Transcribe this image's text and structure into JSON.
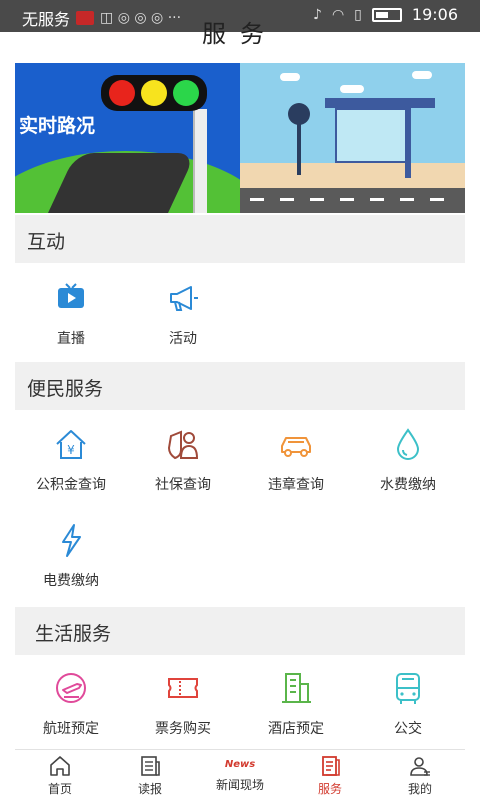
{
  "status_bar": {
    "carrier": "无服务",
    "time": "19:06"
  },
  "header": {
    "title": "服务"
  },
  "banner": {
    "left_text": "实时路况"
  },
  "sections": {
    "interaction": {
      "title": "互动",
      "items": [
        {
          "label": "直播",
          "icon": "tv-icon"
        },
        {
          "label": "活动",
          "icon": "megaphone-icon"
        }
      ]
    },
    "convenience": {
      "title": "便民服务",
      "items": [
        {
          "label": "公积金查询",
          "icon": "house-yen-icon"
        },
        {
          "label": "社保查询",
          "icon": "shield-user-icon"
        },
        {
          "label": "违章查询",
          "icon": "car-icon"
        },
        {
          "label": "水费缴纳",
          "icon": "water-drop-icon"
        },
        {
          "label": "电费缴纳",
          "icon": "lightning-icon"
        }
      ]
    },
    "life": {
      "title": "生活服务",
      "items": [
        {
          "label": "航班预定",
          "icon": "plane-icon"
        },
        {
          "label": "票务购买",
          "icon": "ticket-icon"
        },
        {
          "label": "酒店预定",
          "icon": "hotel-icon"
        },
        {
          "label": "公交",
          "icon": "bus-icon"
        }
      ]
    }
  },
  "bottom_nav": {
    "items": [
      {
        "label": "首页",
        "icon": "home-icon"
      },
      {
        "label": "读报",
        "icon": "newspaper-icon"
      },
      {
        "label": "新闻现场",
        "icon": "news-icon",
        "badge": "News"
      },
      {
        "label": "服务",
        "icon": "service-icon",
        "active": true
      },
      {
        "label": "我的",
        "icon": "user-icon"
      }
    ]
  },
  "colors": {
    "accent": "#d23a2e",
    "icon_blue": "#2b8ad6",
    "icon_brown": "#a04a3a",
    "icon_orange": "#f0943a",
    "icon_teal": "#3cc0c8",
    "icon_pink": "#e04a9a",
    "icon_red": "#e0443c",
    "icon_green": "#5ab54a",
    "section_bg": "#f0f0f0"
  }
}
